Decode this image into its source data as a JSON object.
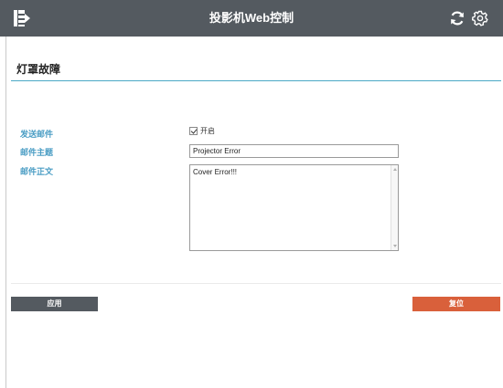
{
  "header": {
    "title": "投影机Web控制",
    "menu_icon": "menu-icon",
    "refresh_icon": "refresh-icon",
    "settings_icon": "gear-icon"
  },
  "section": {
    "title": "灯罩故障"
  },
  "form": {
    "send_mail_label": "发送邮件",
    "enable_label": "开启",
    "enable_checked": true,
    "subject_label": "邮件主题",
    "subject_value": "Projector Error",
    "body_label": "邮件正文",
    "body_value": "Cover Error!!!"
  },
  "actions": {
    "apply_label": "应用",
    "reset_label": "复位"
  },
  "colors": {
    "topbar": "#545a60",
    "label_blue": "#4a9dc4",
    "rule_blue": "#4aa8c6",
    "reset_orange": "#d9603b"
  }
}
